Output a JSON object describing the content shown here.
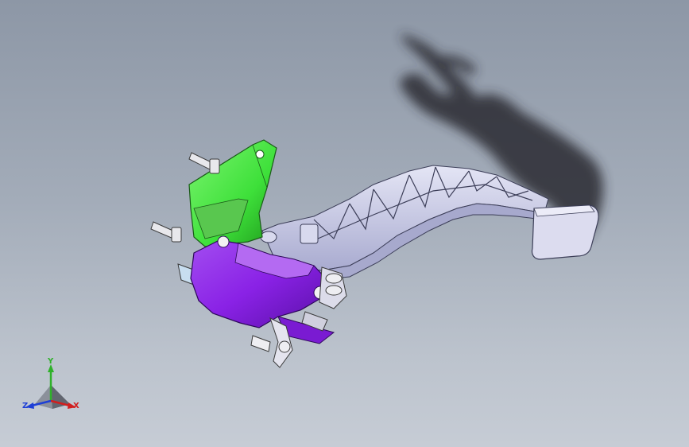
{
  "viewport": {
    "background_top": "#8d97a6",
    "background_bottom": "#c6ccd5"
  },
  "model": {
    "parts": [
      {
        "name": "pedal-arm",
        "color": "#c9cbe8"
      },
      {
        "name": "bracket-upper",
        "color": "#3ee03a"
      },
      {
        "name": "bracket-lower",
        "color": "#8a22e6"
      },
      {
        "name": "pedal-pad",
        "color": "#dcdcef"
      }
    ]
  },
  "triad": {
    "y_label": "Y",
    "x_label": "X",
    "z_label": "Z",
    "y_color": "#2fb12a",
    "x_color": "#d11f1f",
    "z_color": "#1d3fd6"
  }
}
